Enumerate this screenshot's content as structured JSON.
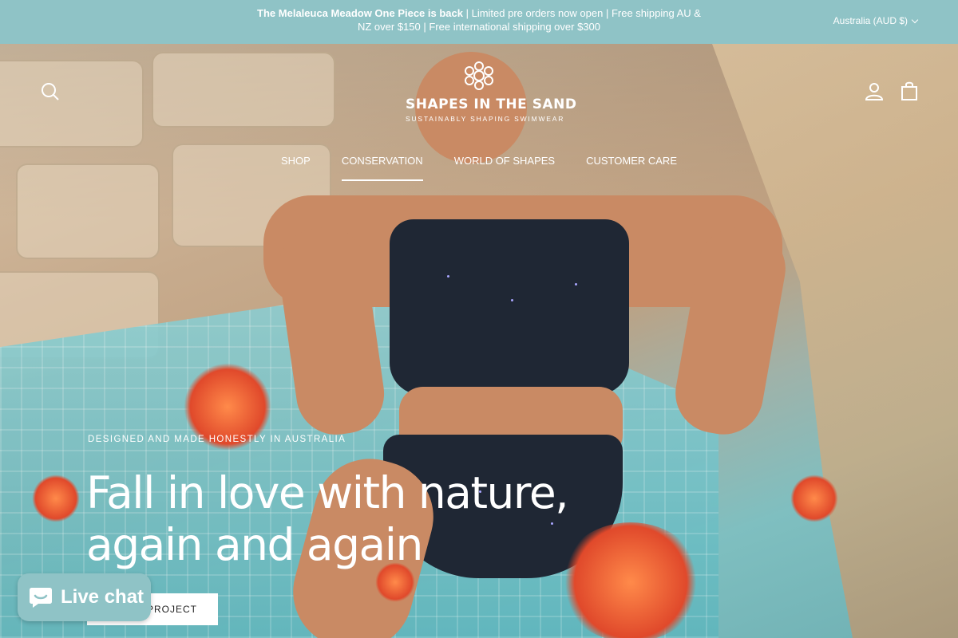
{
  "announcement": {
    "bold": "The Melaleuca Meadow One Piece is back",
    "text": " | Limited pre orders now open | Free shipping AU & NZ over $150 | Free international shipping over $300"
  },
  "currency": {
    "label": "Australia (AUD $)"
  },
  "logo": {
    "title": "SHAPES IN THE SAND",
    "tagline": "SUSTAINABLY SHAPING SWIMWEAR"
  },
  "nav": {
    "items": [
      {
        "label": "SHOP"
      },
      {
        "label": "CONSERVATION"
      },
      {
        "label": "WORLD OF SHAPES"
      },
      {
        "label": "CUSTOMER CARE"
      }
    ]
  },
  "hero": {
    "eyebrow": "DESIGNED AND MADE HONESTLY IN AUSTRALIA",
    "headline_line1": "Fall in love with nature,",
    "headline_line2": "again and again",
    "cta": "R PROJECT"
  },
  "chat": {
    "label": "Live chat"
  },
  "colors": {
    "accent": "#8fc3c6"
  },
  "icons": [
    "search-icon",
    "account-icon",
    "bag-icon",
    "chat-icon",
    "chevron-down-icon"
  ]
}
